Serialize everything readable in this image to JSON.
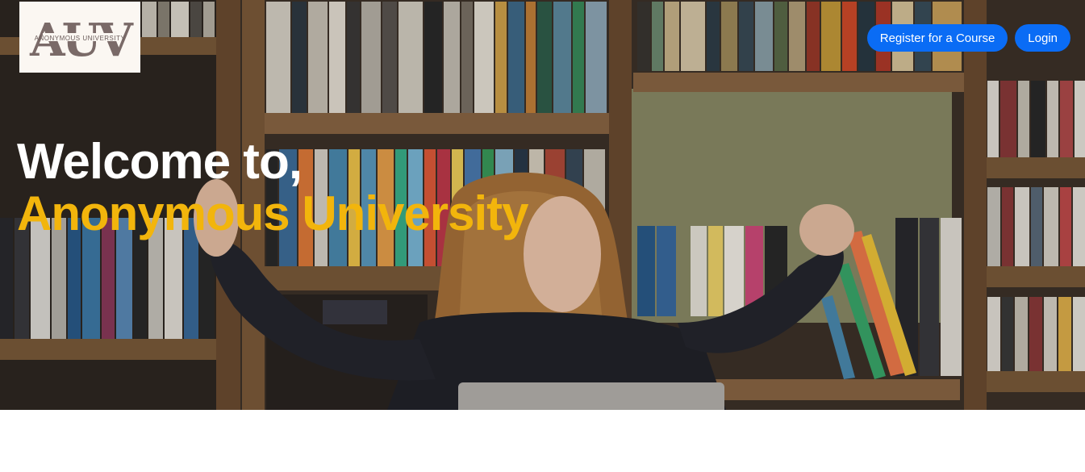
{
  "logo": {
    "mark": "AUV",
    "subtitle": "ANONYMOUS UNIVERSITY"
  },
  "nav": {
    "register_label": "Register for a Course",
    "login_label": "Login"
  },
  "hero": {
    "line1": "Welcome to,",
    "line2": "Anonymous University"
  },
  "colors": {
    "nav_button": "#0a6cf5",
    "headline_accent": "#f2b50c",
    "headline_primary": "#ffffff"
  }
}
